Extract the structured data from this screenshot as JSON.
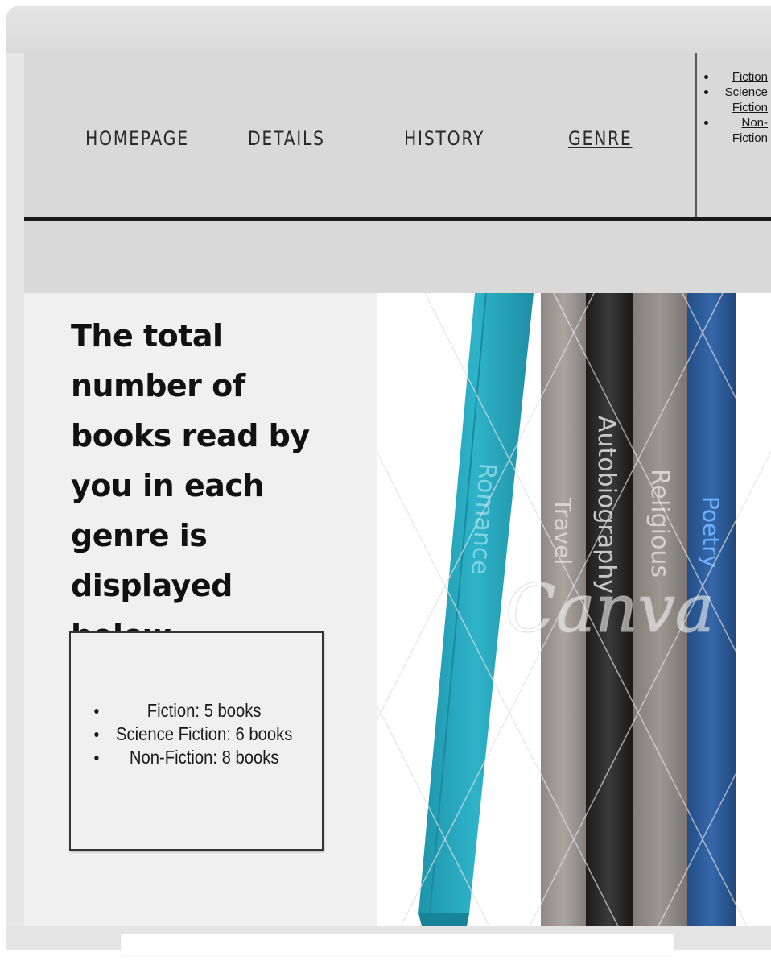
{
  "nav": {
    "items": [
      {
        "label": "HOMEPAGE"
      },
      {
        "label": "DETAILS"
      },
      {
        "label": "HISTORY"
      },
      {
        "label": "GENRE"
      }
    ],
    "active_index": 3
  },
  "genre_menu": {
    "items": [
      {
        "label": "Fiction"
      },
      {
        "label": "Science Fiction"
      },
      {
        "label": "Non-Fiction"
      }
    ]
  },
  "main": {
    "headline": "The total number of books read by you in each genre is displayed below.",
    "stats": [
      "Fiction: 5 books",
      "Science Fiction: 6 books",
      "Non-Fiction: 8 books"
    ]
  },
  "image": {
    "spine_labels": [
      "Romance",
      "Travel",
      "Autobiography",
      "Religious",
      "Poetry"
    ],
    "watermark": "Canva"
  },
  "colors": {
    "nav_background": "#d9d9d9",
    "page_background": "#f0f0f0",
    "romance_book": "#2aa8bf",
    "travel_book": "#9a9590",
    "autobiography_book": "#2b2b2b",
    "religious_book": "#8e8a86",
    "poetry_book": "#2f5e9c"
  }
}
